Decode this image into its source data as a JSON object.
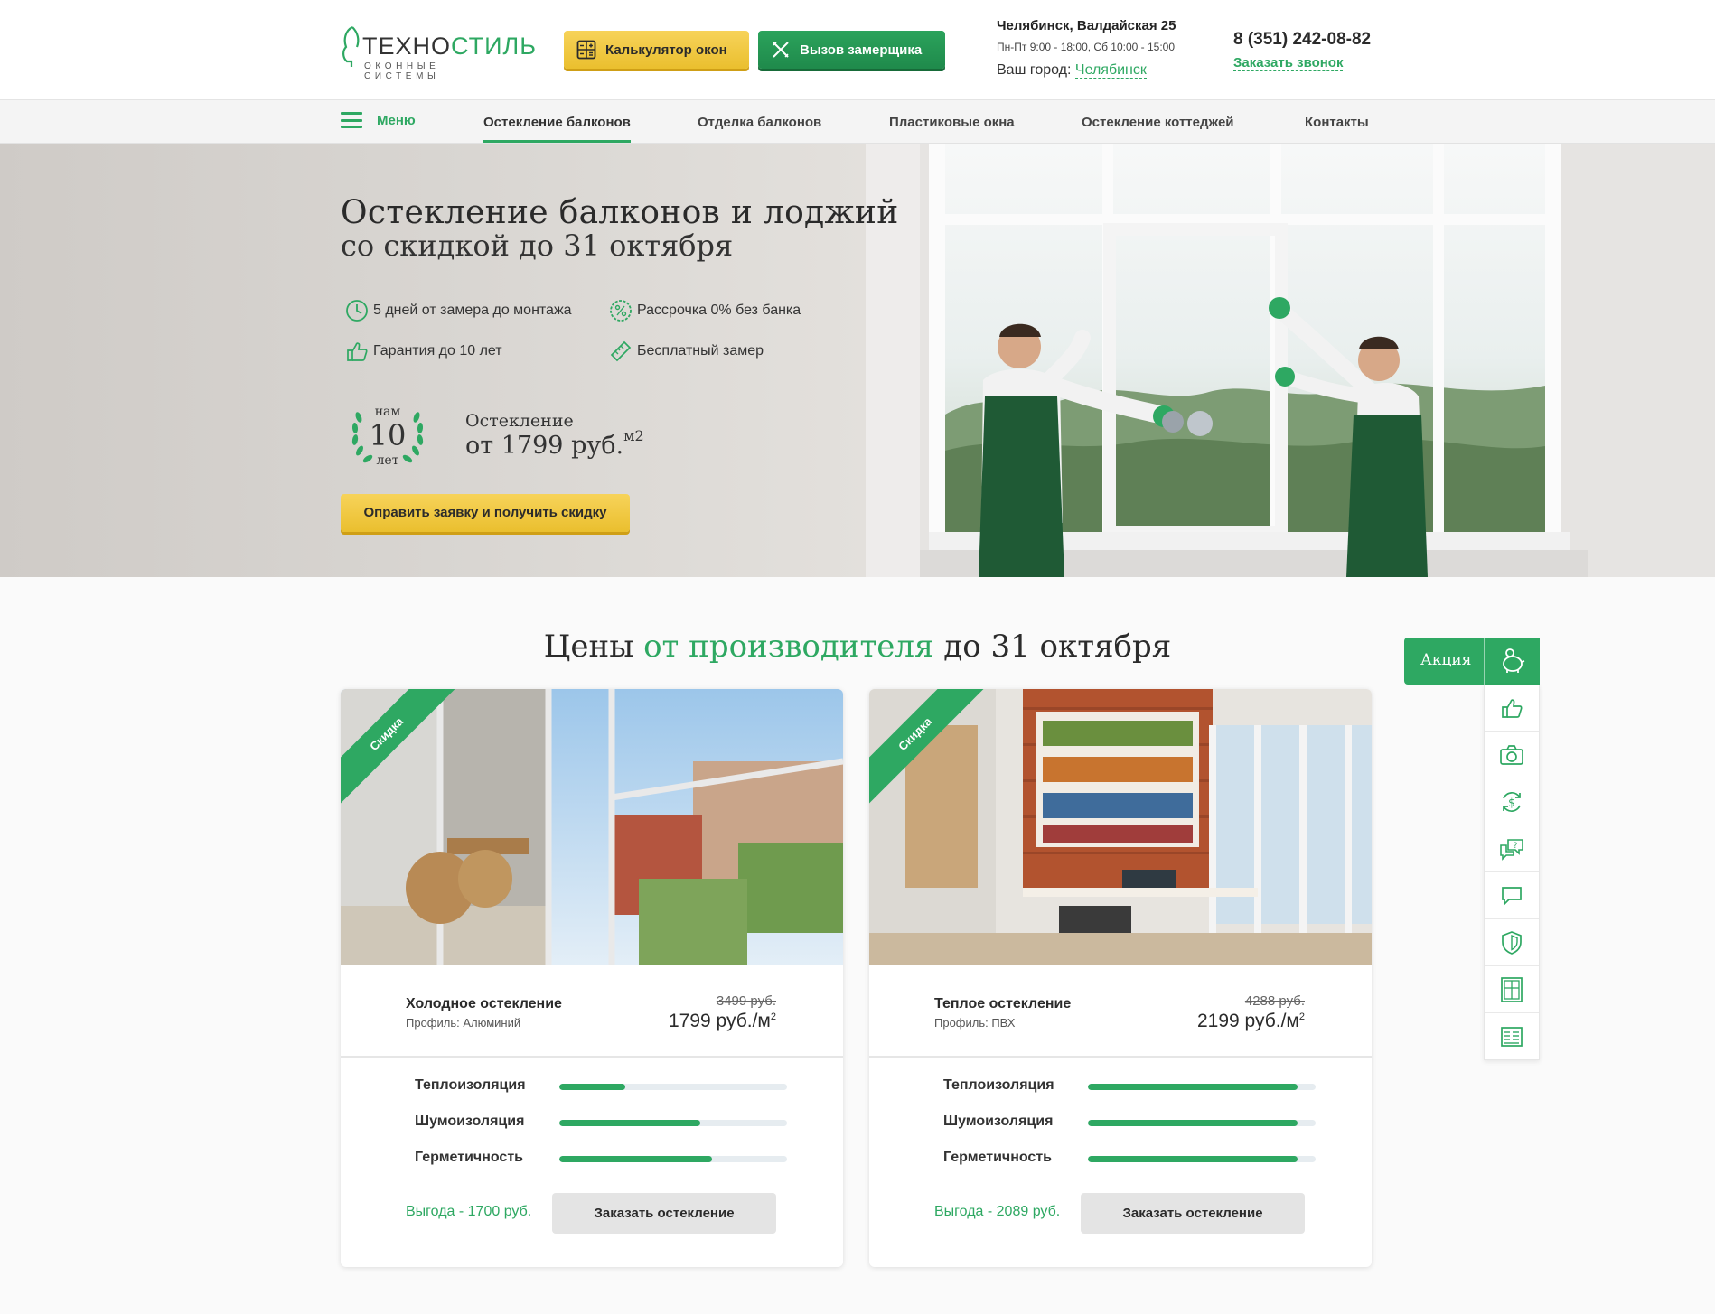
{
  "brand": {
    "name_dark": "ТЕХНО",
    "name_green": "СТИЛЬ",
    "tagline": "ОКОННЫЕ СИСТЕМЫ",
    "green": "#2ea862",
    "yellow": "#f2c843"
  },
  "header": {
    "calc_label": "Калькулятор окон",
    "measure_label": "Вызов замерщика",
    "address": "Челябинск, Валдайская 25",
    "hours": "Пн-Пт 9:00 - 18:00, Сб 10:00 - 15:00",
    "city_label": "Ваш город:",
    "city": "Челябинск",
    "phone": "8 (351) 242-08-82",
    "callback": "Заказать звонок"
  },
  "nav": {
    "menu": "Меню",
    "items": [
      "Остекление балконов",
      "Отделка балконов",
      "Пластиковые окна",
      "Остекление коттеджей",
      "Контакты"
    ],
    "active_index": 0
  },
  "hero": {
    "title": "Остекление балконов и лоджий",
    "subtitle": "со скидкой до 31 октября",
    "features": [
      {
        "icon": "clock-icon",
        "text": "5 дней от замера до монтажа"
      },
      {
        "icon": "percent-icon",
        "text": "Рассрочка 0% без банка"
      },
      {
        "icon": "thumbs-up-icon",
        "text": "Гарантия до 10 лет"
      },
      {
        "icon": "ruler-icon",
        "text": "Бесплатный замер"
      }
    ],
    "years_top": "нам",
    "years_num": "10",
    "years_bot": "лет",
    "price_label": "Остекление",
    "price_value": "от 1799 руб.",
    "price_unit": "м2",
    "cta": "Оправить заявку и получить скидку"
  },
  "prices": {
    "title_pre": "Цены ",
    "title_green": "от производителя",
    "title_post": " до 31 октября",
    "cards": [
      {
        "ribbon": "Скидка",
        "name": "Холодное остекление",
        "profile": "Профиль: Алюминий",
        "old_price": "3499 руб.",
        "new_price": "1799 руб./м",
        "unit_sup": "2",
        "bars": [
          {
            "label": "Теплоизоляция",
            "value": 0.29
          },
          {
            "label": "Шумоизоляция",
            "value": 0.62
          },
          {
            "label": "Герметичность",
            "value": 0.67
          }
        ],
        "benefit": "Выгода - 1700 руб.",
        "button": "Заказать остекление"
      },
      {
        "ribbon": "Скидка",
        "name": "Теплое остекление",
        "profile": "Профиль: ПВХ",
        "old_price": "4288 руб.",
        "new_price": "2199 руб./м",
        "unit_sup": "2",
        "bars": [
          {
            "label": "Теплоизоляция",
            "value": 0.92
          },
          {
            "label": "Шумоизоляция",
            "value": 0.92
          },
          {
            "label": "Герметичность",
            "value": 0.92
          }
        ],
        "benefit": "Выгода - 2089 руб.",
        "button": "Заказать остекление"
      }
    ]
  },
  "side": {
    "promo": "Акция",
    "items": [
      "thumbs-up-icon",
      "camera-icon",
      "money-refresh-icon",
      "question-chat-icon",
      "chat-icon",
      "shield-icon",
      "window-icon",
      "list-doc-icon"
    ]
  }
}
